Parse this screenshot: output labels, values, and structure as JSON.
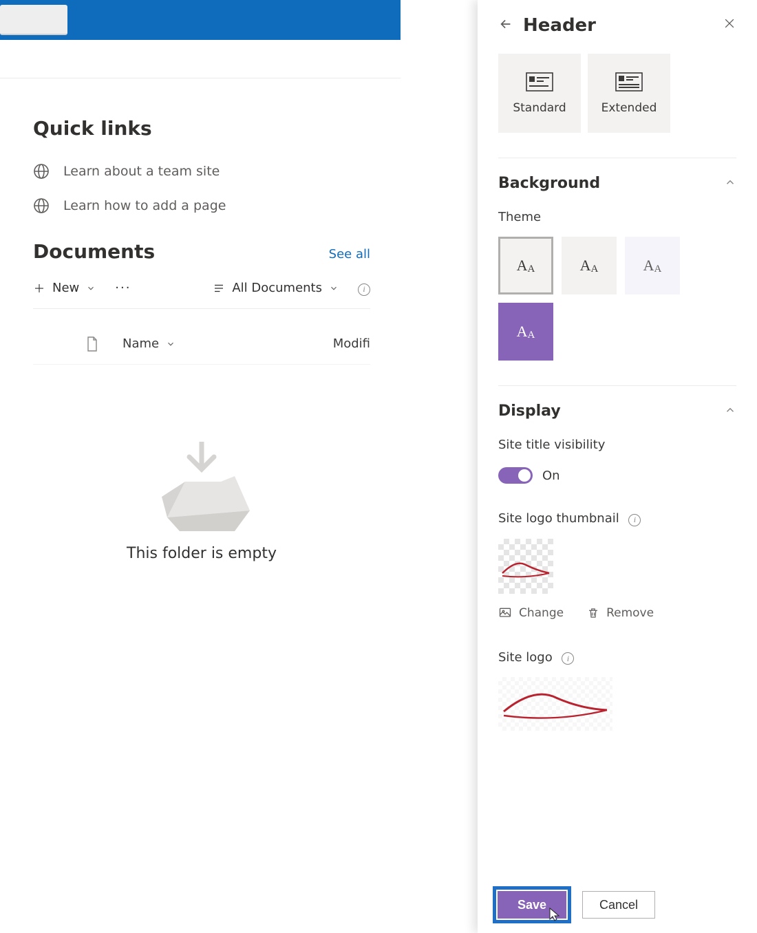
{
  "colors": {
    "accent": "#8764b8",
    "blue_bar": "#0f6cbd",
    "highlight": "#1f6fc6"
  },
  "main": {
    "quick_links": {
      "heading": "Quick links",
      "items": [
        {
          "label": "Learn about a team site"
        },
        {
          "label": "Learn how to add a page"
        }
      ]
    },
    "documents": {
      "heading": "Documents",
      "see_all": "See all",
      "toolbar": {
        "new_label": "New",
        "view_label": "All Documents"
      },
      "columns": {
        "name": "Name",
        "modified": "Modifi"
      },
      "empty_text": "This folder is empty"
    }
  },
  "panel": {
    "title": "Header",
    "layouts": [
      {
        "label": "Standard"
      },
      {
        "label": "Extended"
      }
    ],
    "background": {
      "section_title": "Background",
      "theme_label": "Theme",
      "themes": [
        {
          "style": "light",
          "selected": true
        },
        {
          "style": "light"
        },
        {
          "style": "pale"
        },
        {
          "style": "violet"
        }
      ]
    },
    "display": {
      "section_title": "Display",
      "site_title_vis_label": "Site title visibility",
      "toggle": {
        "value": "On",
        "checked": true
      },
      "thumb_label": "Site logo thumbnail",
      "logo_label": "Site logo",
      "change_label": "Change",
      "remove_label": "Remove"
    },
    "footer": {
      "save": "Save",
      "cancel": "Cancel"
    }
  }
}
